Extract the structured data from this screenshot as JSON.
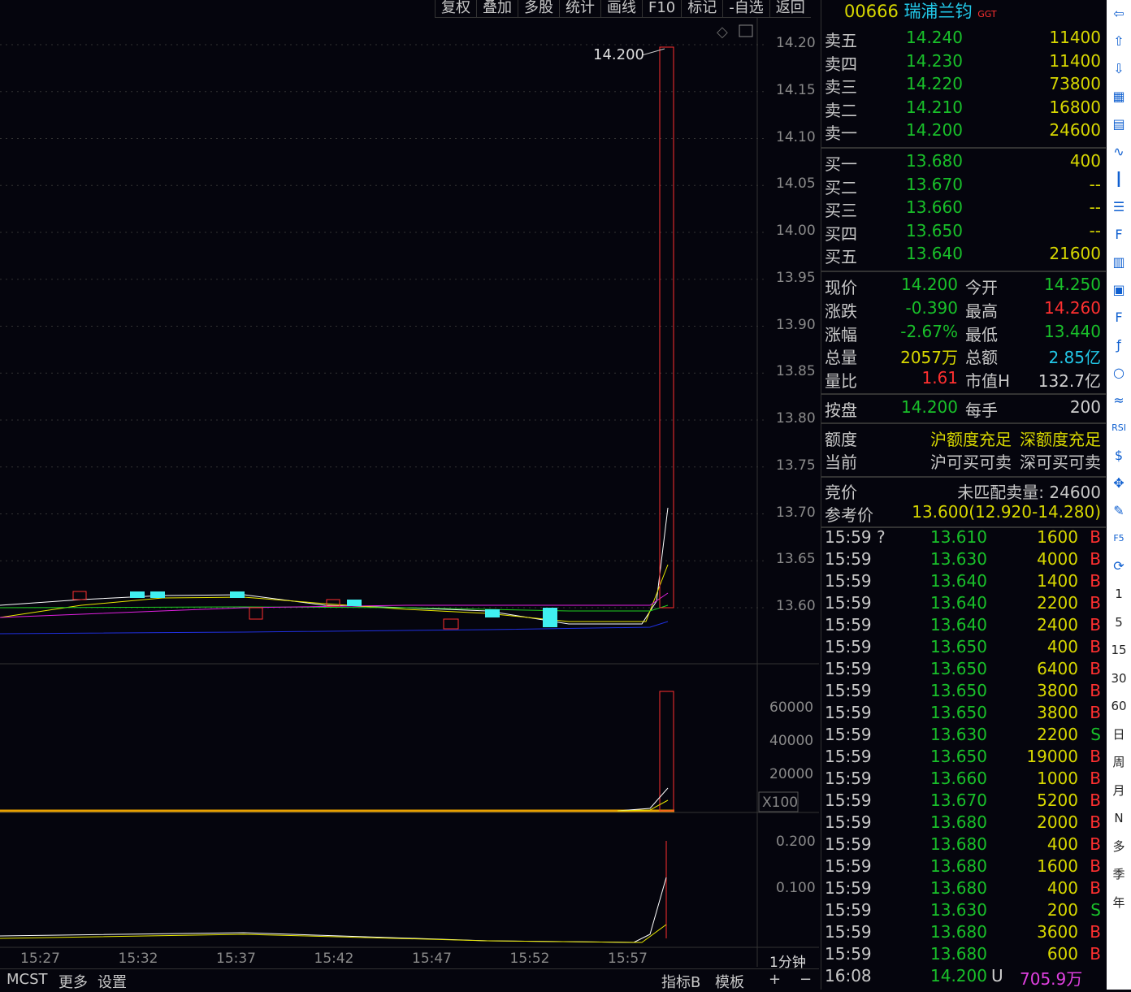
{
  "toolbar": [
    "复权",
    "叠加",
    "多股",
    "统计",
    "画线",
    "F10",
    "标记",
    "-自选",
    "返回"
  ],
  "stock": {
    "code": "00666",
    "name": "瑞浦兰钧",
    "tag": "GGT"
  },
  "chart": {
    "last_price_label": "14.200",
    "price_axis": [
      "14.20",
      "14.15",
      "14.10",
      "14.05",
      "14.00",
      "13.95",
      "13.90",
      "13.85",
      "13.80",
      "13.75",
      "13.70",
      "13.65",
      "13.60"
    ],
    "volume_axis": [
      "60000",
      "40000",
      "20000"
    ],
    "volume_unit": "X100",
    "indicator_axis": [
      "0.200",
      "0.100"
    ],
    "time_axis": [
      "15:27",
      "15:32",
      "15:37",
      "15:42",
      "15:47",
      "15:52",
      "15:57"
    ],
    "period": "1分钟"
  },
  "bottom": {
    "left": [
      "MCST",
      "更多",
      "设置"
    ],
    "right": [
      "指标B",
      "模板",
      "+",
      "−"
    ]
  },
  "asks": [
    {
      "label": "卖五",
      "price": "14.240",
      "vol": "11400"
    },
    {
      "label": "卖四",
      "price": "14.230",
      "vol": "11400"
    },
    {
      "label": "卖三",
      "price": "14.220",
      "vol": "73800"
    },
    {
      "label": "卖二",
      "price": "14.210",
      "vol": "16800"
    },
    {
      "label": "卖一",
      "price": "14.200",
      "vol": "24600"
    }
  ],
  "bids": [
    {
      "label": "买一",
      "price": "13.680",
      "vol": "400"
    },
    {
      "label": "买二",
      "price": "13.670",
      "vol": "--"
    },
    {
      "label": "买三",
      "price": "13.660",
      "vol": "--"
    },
    {
      "label": "买四",
      "price": "13.650",
      "vol": "--"
    },
    {
      "label": "买五",
      "price": "13.640",
      "vol": "21600"
    }
  ],
  "stats": [
    {
      "l1": "现价",
      "v1": "14.200",
      "l2": "今开",
      "v2": "14.250"
    },
    {
      "l1": "涨跌",
      "v1": "-0.390",
      "l2": "最高",
      "v2": "14.260"
    },
    {
      "l1": "涨幅",
      "v1": "-2.67%",
      "l2": "最低",
      "v2": "13.440"
    },
    {
      "l1": "总量",
      "v1": "2057万",
      "l2": "总额",
      "v2": "2.85亿"
    },
    {
      "l1": "量比",
      "v1": "1.61",
      "l2": "市值H",
      "v2": "132.7亿"
    }
  ],
  "board": {
    "l1": "按盘",
    "v1": "14.200",
    "l2": "每手",
    "v2": "200"
  },
  "quota": {
    "label": "额度",
    "sh": "沪额度充足",
    "sz": "深额度充足"
  },
  "current": {
    "label": "当前",
    "sh": "沪可买可卖",
    "sz": "深可买可卖"
  },
  "auction": {
    "label": "竞价",
    "value": "未匹配卖量: 24600"
  },
  "ref": {
    "label": "参考价",
    "value": "13.600(12.920-14.280)"
  },
  "trades": [
    [
      "15:59 ?",
      "13.610",
      "1600",
      "B"
    ],
    [
      "15:59",
      "13.630",
      "4000",
      "B"
    ],
    [
      "15:59",
      "13.640",
      "1400",
      "B"
    ],
    [
      "15:59",
      "13.640",
      "2200",
      "B"
    ],
    [
      "15:59",
      "13.640",
      "2400",
      "B"
    ],
    [
      "15:59",
      "13.650",
      "400",
      "B"
    ],
    [
      "15:59",
      "13.650",
      "6400",
      "B"
    ],
    [
      "15:59",
      "13.650",
      "3800",
      "B"
    ],
    [
      "15:59",
      "13.650",
      "3800",
      "B"
    ],
    [
      "15:59",
      "13.630",
      "2200",
      "S"
    ],
    [
      "15:59",
      "13.650",
      "19000",
      "B"
    ],
    [
      "15:59",
      "13.660",
      "1000",
      "B"
    ],
    [
      "15:59",
      "13.670",
      "5200",
      "B"
    ],
    [
      "15:59",
      "13.680",
      "2000",
      "B"
    ],
    [
      "15:59",
      "13.680",
      "400",
      "B"
    ],
    [
      "15:59",
      "13.680",
      "1600",
      "B"
    ],
    [
      "15:59",
      "13.680",
      "400",
      "B"
    ],
    [
      "15:59",
      "13.630",
      "200",
      "S"
    ],
    [
      "15:59",
      "13.680",
      "3600",
      "B"
    ],
    [
      "15:59",
      "13.680",
      "600",
      "B"
    ]
  ],
  "last_trade": {
    "time": "16:08",
    "price": "14.200",
    "flag": "U",
    "amount": "705.9万"
  },
  "sidebar_periods": [
    "1",
    "5",
    "15",
    "30",
    "60",
    "日",
    "周",
    "月",
    "N",
    "多",
    "季",
    "年"
  ]
}
